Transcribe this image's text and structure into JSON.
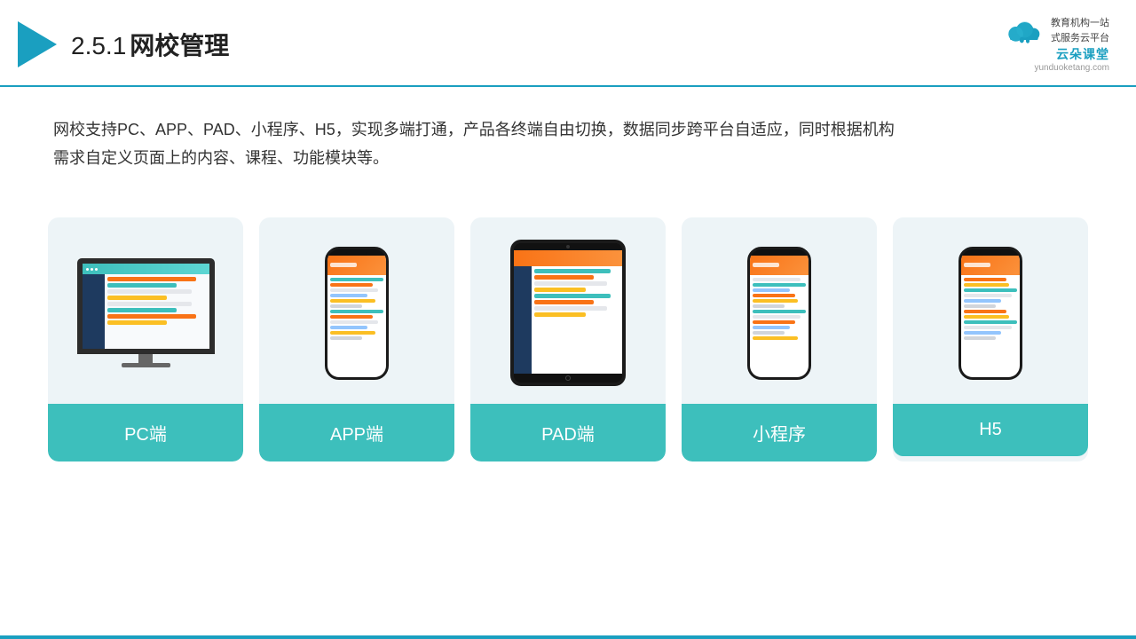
{
  "header": {
    "section_number": "2.5.1",
    "title": "网校管理",
    "brand": {
      "name": "云朵课堂",
      "url": "yunduoketang.com",
      "slogan_line1": "教育机构一站",
      "slogan_line2": "式服务云平台"
    }
  },
  "description": {
    "text": "网校支持PC、APP、PAD、小程序、H5，实现多端打通，产品各终端自由切换，数据同步跨平台自适应，同时根据机构需求自定义页面上的内容、课程、功能模块等。"
  },
  "cards": [
    {
      "id": "pc",
      "label": "PC端",
      "device_type": "pc"
    },
    {
      "id": "app",
      "label": "APP端",
      "device_type": "phone"
    },
    {
      "id": "pad",
      "label": "PAD端",
      "device_type": "tablet"
    },
    {
      "id": "miniprogram",
      "label": "小程序",
      "device_type": "phone"
    },
    {
      "id": "h5",
      "label": "H5",
      "device_type": "phone"
    }
  ],
  "colors": {
    "accent": "#3dbfbc",
    "header_border": "#1a9fc0",
    "card_bg": "#edf4f7",
    "card_label_bg": "#3dbfbc",
    "card_label_text": "#ffffff",
    "title_color": "#222222",
    "desc_color": "#333333",
    "brand_color": "#1a9fc0"
  }
}
